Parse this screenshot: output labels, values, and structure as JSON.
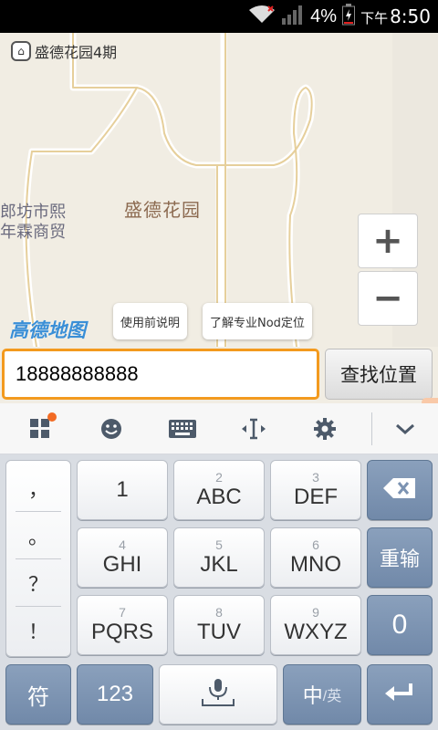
{
  "status_bar": {
    "battery_percent": "4%",
    "time_prefix": "下午",
    "time": "8:50"
  },
  "map": {
    "poi_label": "盛德花园4期",
    "area_label": "盛德花园",
    "city_label_line1": "郎坊市熙",
    "city_label_line2": "年霖商贸",
    "logo_text": "高德地图",
    "bubble_1": "使用前说明",
    "bubble_2": "了解专业Nod定位",
    "zoom_in_label": "+",
    "zoom_out_label": "−"
  },
  "search": {
    "input_value": "18888888888",
    "button_label": "查找位置"
  },
  "keyboard": {
    "punctuation": [
      "，",
      "。",
      "？",
      "！"
    ],
    "keys": [
      {
        "num": "",
        "letters": "1"
      },
      {
        "num": "2",
        "letters": "ABC"
      },
      {
        "num": "3",
        "letters": "DEF"
      },
      {
        "num": "4",
        "letters": "GHI"
      },
      {
        "num": "5",
        "letters": "JKL"
      },
      {
        "num": "6",
        "letters": "MNO"
      },
      {
        "num": "7",
        "letters": "PQRS"
      },
      {
        "num": "8",
        "letters": "TUV"
      },
      {
        "num": "9",
        "letters": "WXYZ"
      }
    ],
    "reinput_label": "重输",
    "zero_label": "0",
    "symbol_label": "符",
    "numbers_label": "123",
    "lang_primary": "中",
    "lang_secondary": "/英"
  },
  "colors": {
    "input_border": "#f39a1e",
    "logo_blue": "#3b8fd6",
    "dark_key": "#7c93b2",
    "notification_dot": "#f26b24"
  },
  "icons": [
    "wifi-icon",
    "signal-icon",
    "battery-icon",
    "apps-icon",
    "emoji-icon",
    "keyboard-icon",
    "cursor-icon",
    "gear-icon",
    "chevron-down-icon",
    "backspace-icon",
    "mic-icon",
    "enter-icon",
    "home-pin-icon"
  ]
}
